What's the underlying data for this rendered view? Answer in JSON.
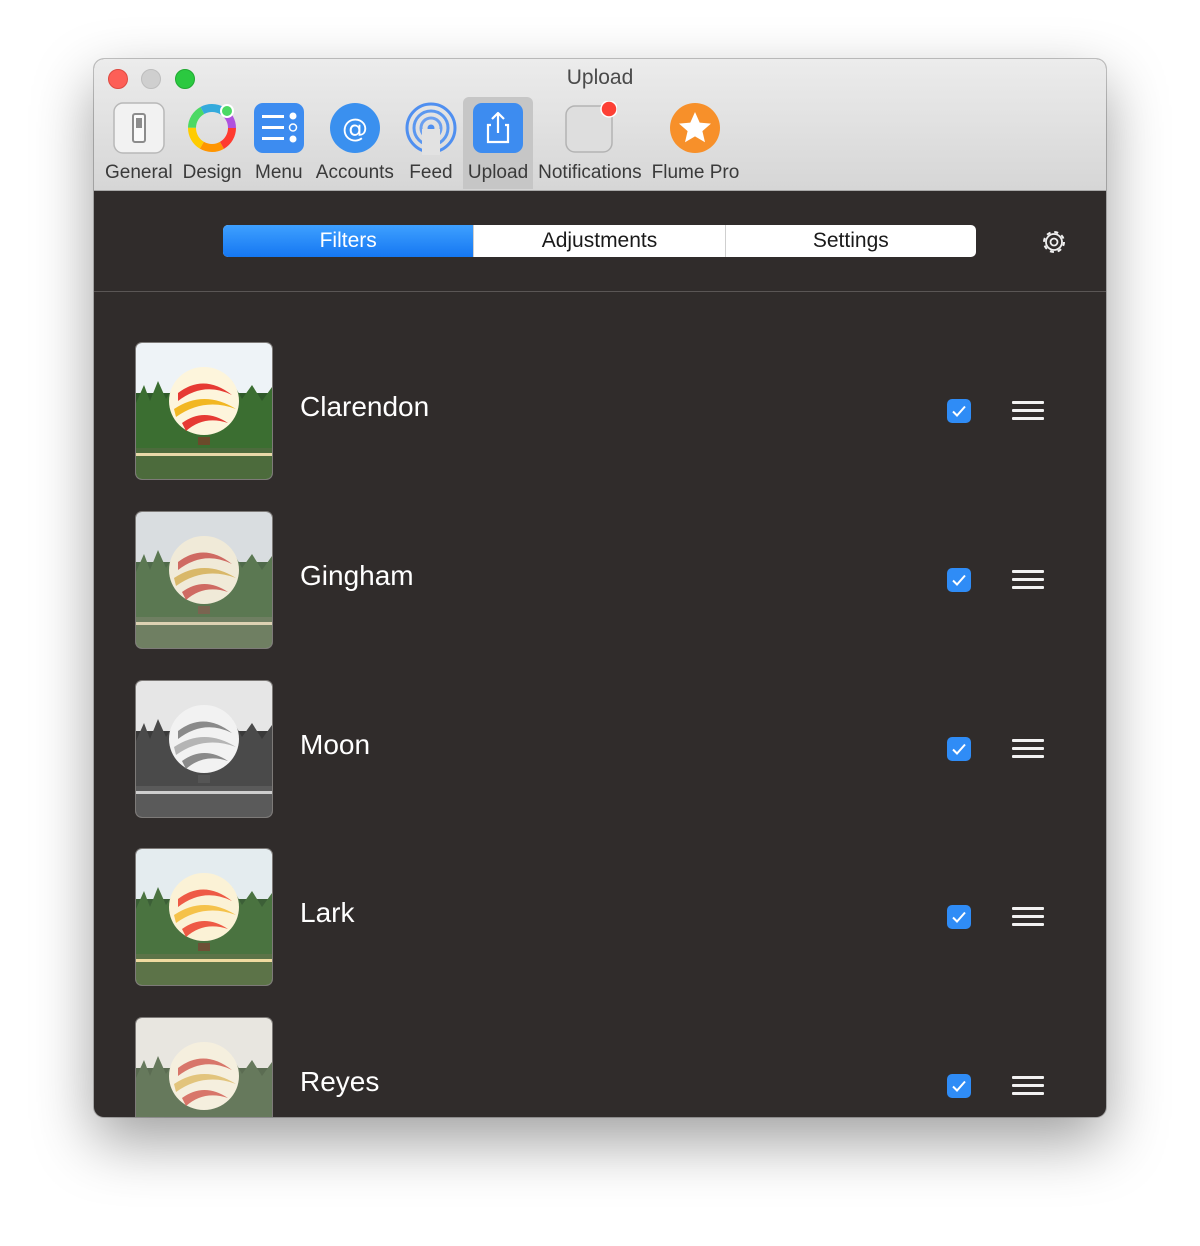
{
  "window": {
    "title": "Upload"
  },
  "toolbar": {
    "items": [
      {
        "label": "General",
        "icon": "switch-icon"
      },
      {
        "label": "Design",
        "icon": "color-wheel-icon"
      },
      {
        "label": "Menu",
        "icon": "menu-list-icon"
      },
      {
        "label": "Accounts",
        "icon": "at-sign-icon"
      },
      {
        "label": "Feed",
        "icon": "broadcast-icon"
      },
      {
        "label": "Upload",
        "icon": "share-upload-icon",
        "active": true
      },
      {
        "label": "Notifications",
        "icon": "notification-badge-icon"
      },
      {
        "label": "Flume Pro",
        "icon": "star-icon"
      }
    ]
  },
  "tabs": {
    "items": [
      {
        "label": "Filters",
        "active": true
      },
      {
        "label": "Adjustments"
      },
      {
        "label": "Settings"
      }
    ]
  },
  "filters": {
    "items": [
      {
        "name": "Clarendon",
        "checked": true
      },
      {
        "name": "Gingham",
        "checked": true
      },
      {
        "name": "Moon",
        "checked": true
      },
      {
        "name": "Lark",
        "checked": true
      },
      {
        "name": "Reyes",
        "checked": true
      }
    ]
  },
  "colors": {
    "accent": "#2f8cf6",
    "background": "#302c2b"
  }
}
